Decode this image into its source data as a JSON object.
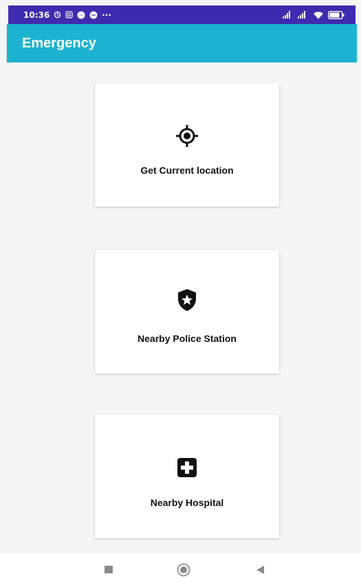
{
  "status_bar": {
    "time": "10:36",
    "more": "···",
    "battery": "75"
  },
  "app_bar": {
    "title": "Emergency"
  },
  "cards": [
    {
      "label": "Get Current location",
      "icon": "my-location-icon"
    },
    {
      "label": "Nearby Police Station",
      "icon": "police-shield-icon"
    },
    {
      "label": "Nearby Hospital",
      "icon": "hospital-cross-icon"
    }
  ],
  "nav_bar": {
    "icons": [
      "recent-apps-icon",
      "home-icon",
      "back-icon"
    ]
  },
  "colors": {
    "status_bar": "#3f2bb0",
    "app_bar": "#1cb3d1",
    "background": "#f5f5f5"
  }
}
